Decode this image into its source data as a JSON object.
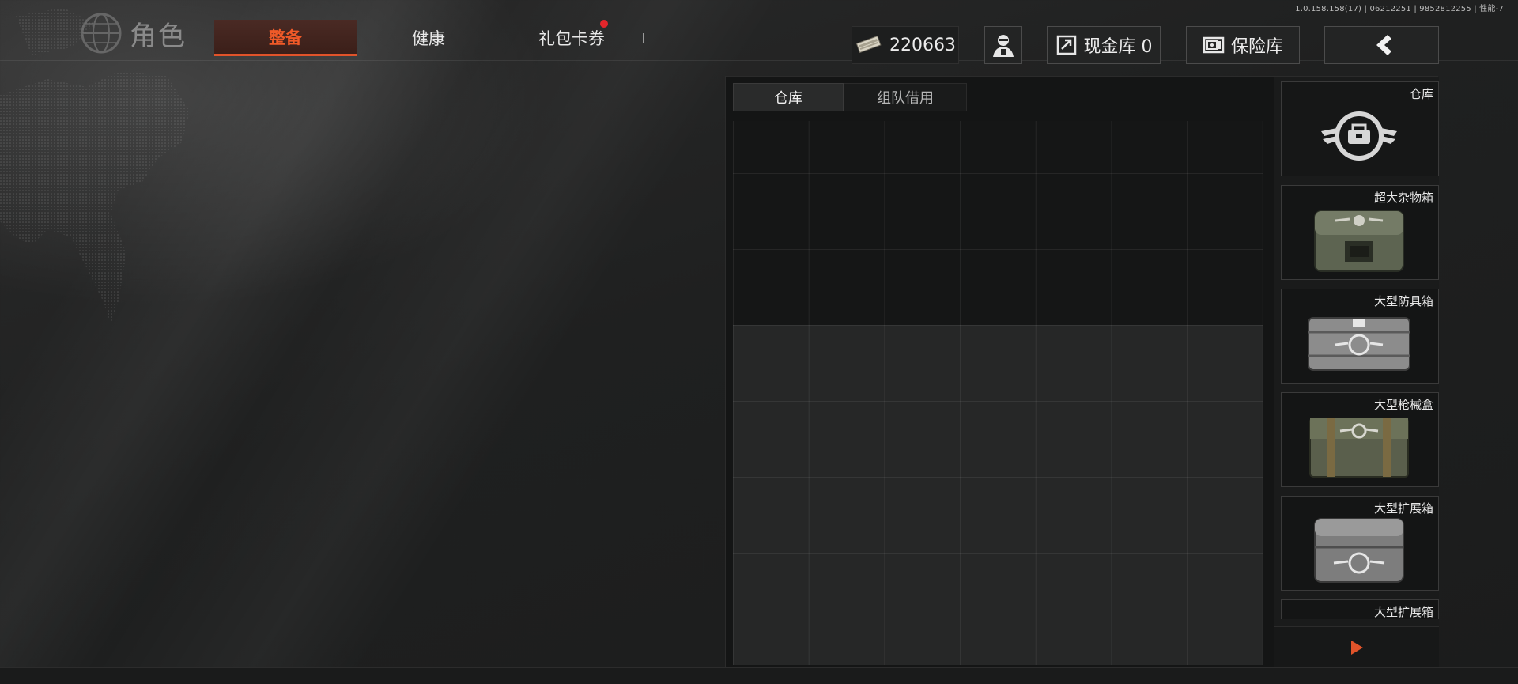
{
  "version_info": "1.0.158.158(17) | 06212251 | 9852812255 | 性能-7",
  "header": {
    "role_label": "角色",
    "tabs": [
      {
        "label": "整备",
        "active": true
      },
      {
        "label": "健康",
        "active": false
      },
      {
        "label": "礼包卡券",
        "active": false,
        "has_notification": true
      }
    ],
    "currency_value": "220663",
    "cash_vault_label": "现金库 0",
    "safe_label": "保险库"
  },
  "warehouse": {
    "subtabs": [
      {
        "label": "仓库",
        "active": true
      },
      {
        "label": "组队借用",
        "active": false
      }
    ],
    "containers": [
      {
        "label": "仓库",
        "icon": "warehouse-wing-emblem-icon"
      },
      {
        "label": "超大杂物箱",
        "color": "olive"
      },
      {
        "label": "大型防具箱",
        "color": "silver"
      },
      {
        "label": "大型枪械盒",
        "color": "olive"
      },
      {
        "label": "大型扩展箱",
        "color": "silver"
      },
      {
        "label": "大型扩展箱",
        "color": "silver"
      }
    ]
  },
  "colors": {
    "accent": "#e0532a",
    "notification": "#e3262b",
    "background": "#1f2020"
  }
}
